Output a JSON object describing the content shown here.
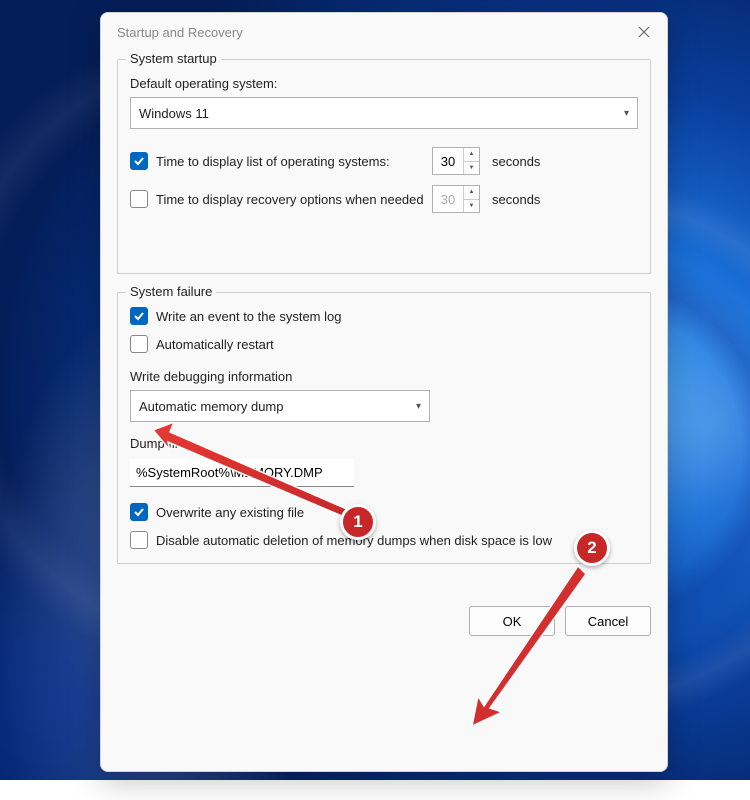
{
  "dialog": {
    "title": "Startup and Recovery"
  },
  "systemStartup": {
    "legend": "System startup",
    "defaultOsLabel": "Default operating system:",
    "defaultOsValue": "Windows 11",
    "timeOsList": {
      "checked": true,
      "label": "Time to display list of operating systems:",
      "value": "30",
      "unit": "seconds"
    },
    "timeRecovery": {
      "checked": false,
      "label": "Time to display recovery options when needed",
      "value": "30",
      "unit": "seconds"
    }
  },
  "systemFailure": {
    "legend": "System failure",
    "writeEvent": {
      "checked": true,
      "label": "Write an event to the system log"
    },
    "autoRestart": {
      "checked": false,
      "label": "Automatically restart"
    },
    "writeDebugLabel": "Write debugging information",
    "debugDumpValue": "Automatic memory dump",
    "dumpFileLabel": "Dump file:",
    "dumpFileValue": "%SystemRoot%\\MEMORY.DMP",
    "overwrite": {
      "checked": true,
      "label": "Overwrite any existing file"
    },
    "disableDelete": {
      "checked": false,
      "label": "Disable automatic deletion of memory dumps when disk space is low"
    }
  },
  "buttons": {
    "ok": "OK",
    "cancel": "Cancel"
  },
  "annotations": {
    "badge1": "1",
    "badge2": "2"
  }
}
